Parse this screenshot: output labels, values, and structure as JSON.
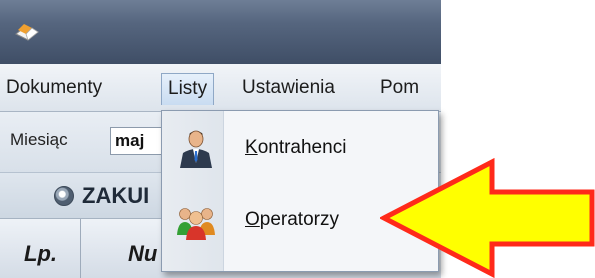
{
  "menubar": {
    "items": [
      {
        "label": "Dokumenty"
      },
      {
        "label": "Listy"
      },
      {
        "label": "Ustawienia"
      },
      {
        "label": "Pom"
      }
    ]
  },
  "toolbar": {
    "month_label": "Miesiąc",
    "month_value": "maj"
  },
  "section": {
    "title": "ZAKUI"
  },
  "grid": {
    "columns": [
      "Lp.",
      "Nu"
    ]
  },
  "dropdown": {
    "items": [
      {
        "mnemonic": "K",
        "rest": "ontrahenci",
        "icon": "business-person-icon"
      },
      {
        "mnemonic": "O",
        "rest": "peratorzy",
        "icon": "users-group-icon"
      }
    ]
  },
  "colors": {
    "arrow_fill": "#ffff00",
    "arrow_stroke": "#ff2a1a",
    "title_bar": "#4a5a72"
  }
}
